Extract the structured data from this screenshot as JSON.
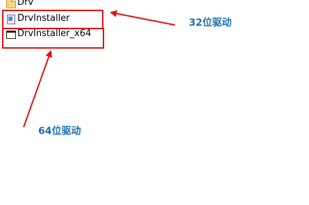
{
  "files": [
    {
      "label": "Drv",
      "icon": "folder-icon"
    },
    {
      "label": "DrvInstaller",
      "icon": "installer-icon"
    },
    {
      "label": "DrvInstaller_x64",
      "icon": "window-icon"
    }
  ],
  "annotations": {
    "x86": "32位驱动",
    "x64": "64位驱动",
    "color": "#1a6fb5",
    "highlight_color": "#e01010"
  }
}
